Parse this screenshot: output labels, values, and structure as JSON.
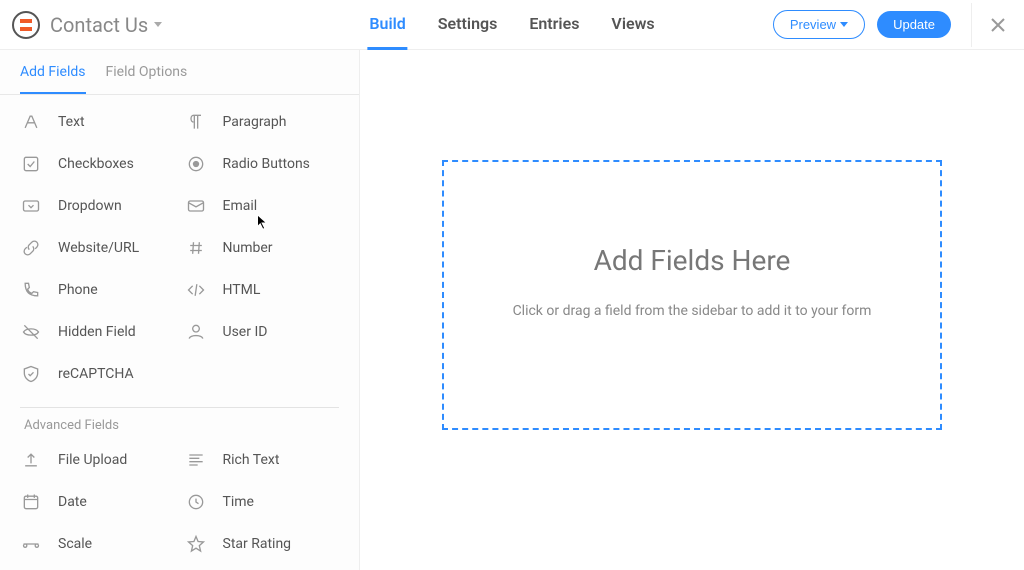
{
  "header": {
    "form_title": "Contact Us",
    "tabs": {
      "build": "Build",
      "settings": "Settings",
      "entries": "Entries",
      "views": "Views"
    },
    "preview_label": "Preview",
    "update_label": "Update"
  },
  "sidebar": {
    "tabs": {
      "add_fields": "Add Fields",
      "field_options": "Field Options"
    },
    "basic_fields": [
      {
        "label": "Text",
        "icon": "text"
      },
      {
        "label": "Paragraph",
        "icon": "paragraph"
      },
      {
        "label": "Checkboxes",
        "icon": "checkbox"
      },
      {
        "label": "Radio Buttons",
        "icon": "radio"
      },
      {
        "label": "Dropdown",
        "icon": "dropdown"
      },
      {
        "label": "Email",
        "icon": "email"
      },
      {
        "label": "Website/URL",
        "icon": "url"
      },
      {
        "label": "Number",
        "icon": "number"
      },
      {
        "label": "Phone",
        "icon": "phone"
      },
      {
        "label": "HTML",
        "icon": "html"
      },
      {
        "label": "Hidden Field",
        "icon": "hidden"
      },
      {
        "label": "User ID",
        "icon": "user"
      },
      {
        "label": "reCAPTCHA",
        "icon": "recaptcha"
      }
    ],
    "advanced_label": "Advanced Fields",
    "advanced_fields": [
      {
        "label": "File Upload",
        "icon": "upload"
      },
      {
        "label": "Rich Text",
        "icon": "richtext"
      },
      {
        "label": "Date",
        "icon": "date"
      },
      {
        "label": "Time",
        "icon": "time"
      },
      {
        "label": "Scale",
        "icon": "scale"
      },
      {
        "label": "Star Rating",
        "icon": "star"
      }
    ]
  },
  "canvas": {
    "title": "Add Fields Here",
    "subtitle": "Click or drag a field from the sidebar to add it to your form"
  }
}
